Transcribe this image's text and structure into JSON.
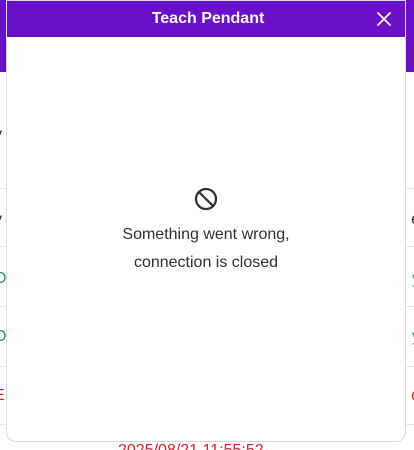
{
  "modal": {
    "title": "Teach Pendant",
    "close_icon": "close-icon",
    "error_icon": "ban-icon",
    "error_message": "Something went wrong, connection is closed"
  },
  "background": {
    "date_partial": "2025/08/21 11:55:52"
  },
  "colors": {
    "brand_purple": "#6a10c8",
    "success_green": "#1f9a55",
    "error_red": "#d4232b",
    "text_dark": "#2a2f3a"
  }
}
